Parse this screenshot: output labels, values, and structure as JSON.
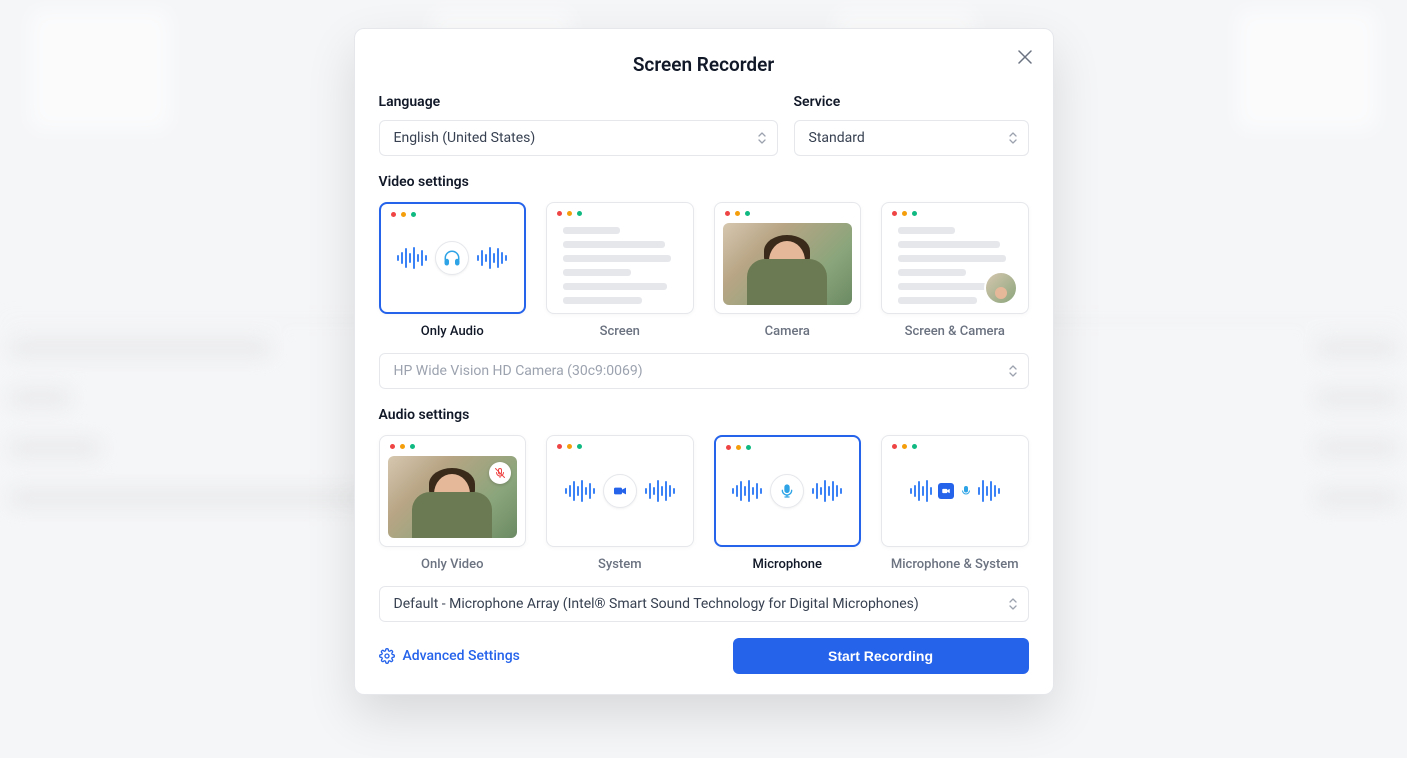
{
  "modal": {
    "title": "Screen Recorder",
    "language": {
      "label": "Language",
      "value": "English (United States)"
    },
    "service": {
      "label": "Service",
      "value": "Standard"
    },
    "video_settings_label": "Video settings",
    "video_options": {
      "only_audio": "Only Audio",
      "screen": "Screen",
      "camera": "Camera",
      "screen_camera": "Screen & Camera",
      "selected": "only_audio"
    },
    "camera_select": "HP Wide Vision HD Camera (30c9:0069)",
    "audio_settings_label": "Audio settings",
    "audio_options": {
      "only_video": "Only Video",
      "system": "System",
      "microphone": "Microphone",
      "mic_system": "Microphone & System",
      "selected": "microphone"
    },
    "mic_select": "Default - Microphone Array (Intel® Smart Sound Technology for Digital Microphones)",
    "advanced_label": "Advanced Settings",
    "start_label": "Start Recording"
  }
}
